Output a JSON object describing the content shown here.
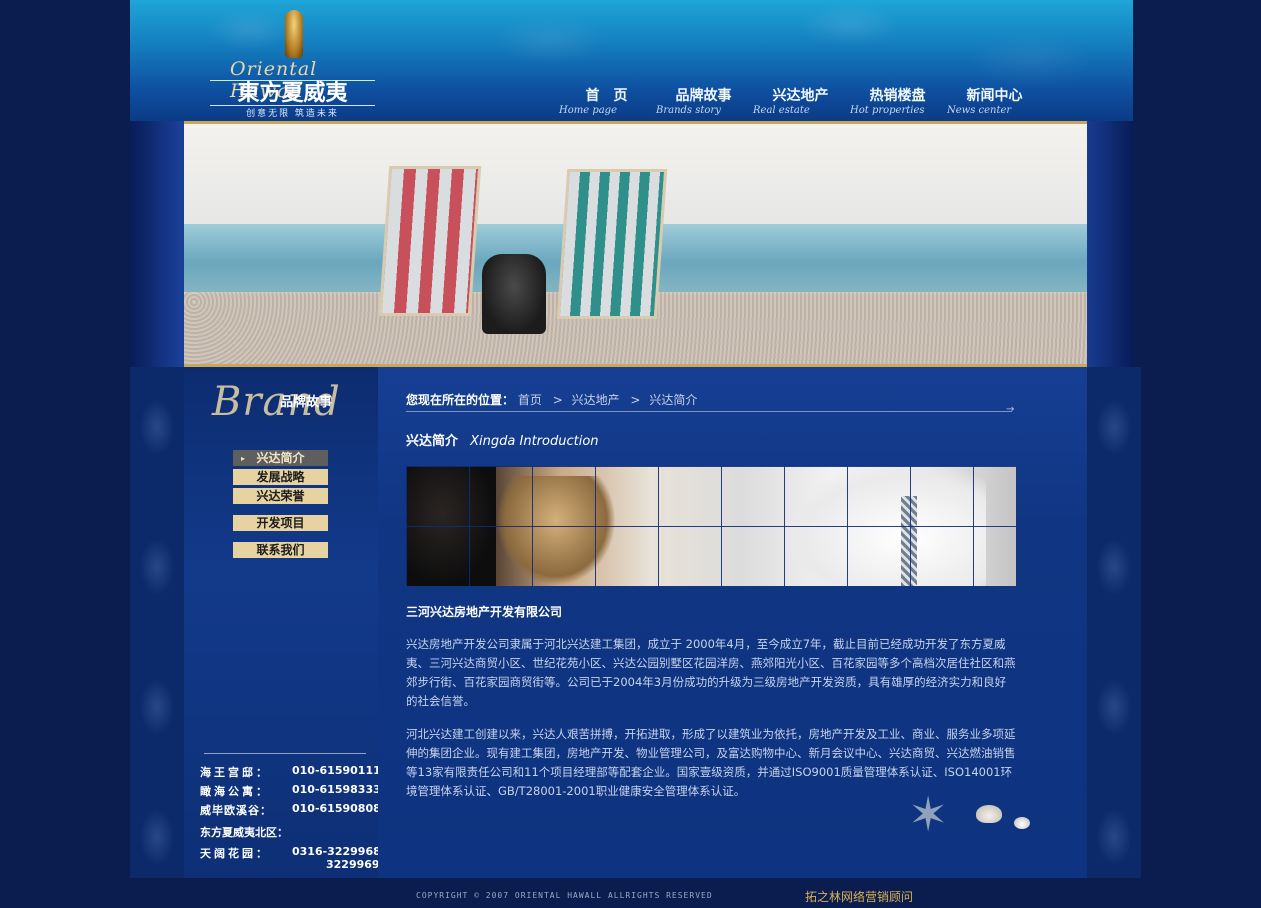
{
  "logo": {
    "script": "Oriental Hawaii",
    "cn": "東方夏威夷",
    "tagline": "创意无限 筑造未来"
  },
  "nav": [
    {
      "cn": "首　页",
      "en": "Home page"
    },
    {
      "cn": "品牌故事",
      "en": "Brands story"
    },
    {
      "cn": "兴达地产",
      "en": "Real estate"
    },
    {
      "cn": "热销楼盘",
      "en": "Hot properties"
    },
    {
      "cn": "新闻中心",
      "en": "News center"
    }
  ],
  "brand": {
    "script": "Brand",
    "cn": "品牌故事"
  },
  "sidemenu": [
    {
      "label": "兴达简介",
      "active": true
    },
    {
      "label": "发展战略",
      "active": false
    },
    {
      "label": "兴达荣誉",
      "active": false
    },
    {
      "label": "开发项目",
      "active": false
    },
    {
      "label": "联系我们",
      "active": false
    }
  ],
  "contacts": [
    {
      "k": "海王宫邸：",
      "v": "010-61590111"
    },
    {
      "k": "瞰海公寓：",
      "v": "010-61598333"
    },
    {
      "k": "威毕欧溪谷：",
      "v": "010-61590808"
    },
    {
      "k": "东方夏威夷北区：",
      "v": ""
    },
    {
      "k": "天阔花园：",
      "v": "0316-3229968"
    },
    {
      "k": "",
      "v": "3229969"
    }
  ],
  "breadcrumb": {
    "label": "您现在所在的位置：",
    "items": [
      "首页",
      "兴达地产",
      "兴达简介"
    ],
    "separator": ">"
  },
  "title": {
    "cn": "兴达简介",
    "en": "Xingda Introduction"
  },
  "company": "三河兴达房地产开发有限公司",
  "paragraphs": [
    "兴达房地产开发公司隶属于河北兴达建工集团，成立于 2000年4月，至今成立7年，截止目前已经成功开发了东方夏威夷、三河兴达商贸小区、世纪花苑小区、兴达公园别墅区花园洋房、燕郊阳光小区、百花家园等多个高档次居住社区和燕郊步行街、百花家园商贸街等。公司已于2004年3月份成功的升级为三级房地产开发资质，具有雄厚的经济实力和良好的社会信誉。",
    "河北兴达建工创建以来，兴达人艰苦拼搏，开拓进取，形成了以建筑业为依托，房地产开发及工业、商业、服务业多项延伸的集团企业。现有建工集团，房地产开发、物业管理公司，及富达购物中心、新月会议中心、兴达商贸、兴达燃油销售等13家有限责任公司和11个项目经理部等配套企业。国家壹级资质，并通过ISO9001质量管理体系认证、ISO14001环境管理体系认证、GB/T28001-2001职业健康安全管理体系认证。"
  ],
  "footer": {
    "copyright": "COPYRIGHT © 2007 ORIENTAL HAWALL ALLRIGHTS RESERVED",
    "link": "拓之林网络营销顾问"
  },
  "colors": {
    "page_bg": "#0a1d4e",
    "header_top": "#1ea6d8",
    "main_bg": "#103683",
    "menu_btn": "#e7d3a2",
    "menu_active": "#5e5e5e",
    "gold": "#c9a75a",
    "footer_link": "#d9b256"
  }
}
